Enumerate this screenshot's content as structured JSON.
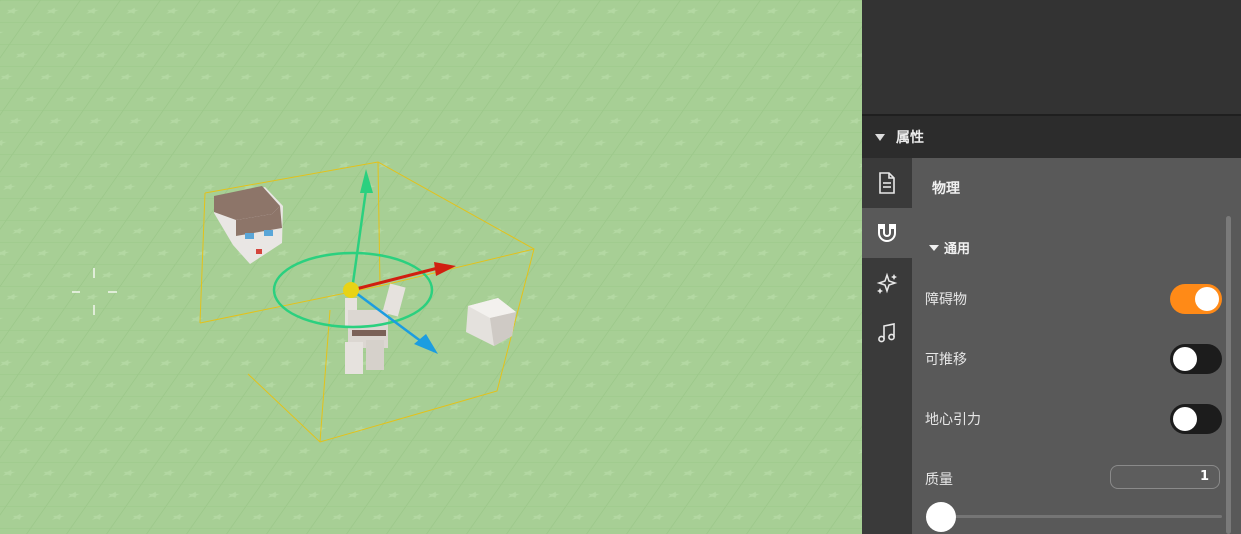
{
  "scene": {
    "description_icons": [
      "crosshair-icon",
      "move-gizmo",
      "rotate-gizmo"
    ],
    "ground_color": "#a7cf95",
    "selection_color": "#e3c21a"
  },
  "panel": {
    "header_title": "属性",
    "tabs": [
      {
        "name": "document-icon",
        "active": false
      },
      {
        "name": "magnet-icon",
        "active": true
      },
      {
        "name": "sparkle-icon",
        "active": false
      },
      {
        "name": "music-icon",
        "active": false
      }
    ],
    "section_title": "物理",
    "group_title": "通用",
    "props": {
      "obstacle": {
        "label": "障碍物",
        "on": true
      },
      "pushable": {
        "label": "可推移",
        "on": false
      },
      "gravity": {
        "label": "地心引力",
        "on": false
      },
      "mass": {
        "label": "质量",
        "value": "1"
      }
    },
    "accent_color": "#ff8a17"
  }
}
